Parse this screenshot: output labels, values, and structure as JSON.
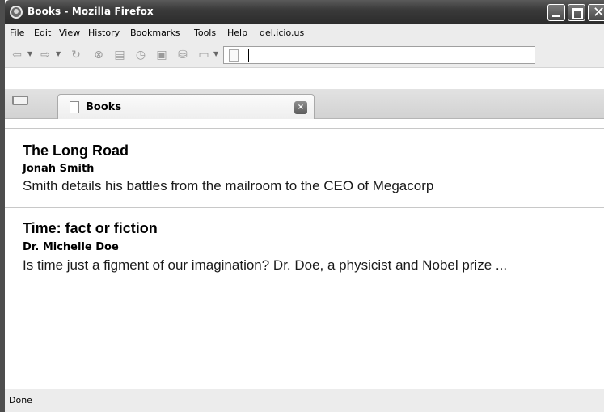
{
  "window": {
    "title": "Books - Mozilla Firefox"
  },
  "window_controls": {
    "minimize": "_",
    "maximize": "□",
    "close": "✕"
  },
  "menubar": {
    "items": [
      "File",
      "Edit",
      "View",
      "History",
      "Bookmarks",
      "Tools",
      "Help",
      "del.icio.us"
    ]
  },
  "toolbar": {
    "icons": [
      "back-icon",
      "forward-icon",
      "reload-icon",
      "stop-icon",
      "print-icon",
      "history-icon",
      "screen-icon",
      "tag-icon",
      "bookmark-menu-icon"
    ],
    "url_value": ""
  },
  "tabs": [
    {
      "label": "Books",
      "close": "×"
    }
  ],
  "books": [
    {
      "title": "The Long Road",
      "author": "Jonah Smith",
      "description": "Smith details his battles from the mailroom to the CEO of Megacorp"
    },
    {
      "title": "Time: fact or fiction",
      "author": "Dr. Michelle Doe",
      "description": "Is time just a figment of our imagination? Dr. Doe, a physicist and Nobel prize ..."
    }
  ],
  "status": {
    "text": "Done"
  },
  "colors": {
    "titlebar": "#3a3a3a",
    "chrome": "#ececec",
    "text": "#000000"
  }
}
